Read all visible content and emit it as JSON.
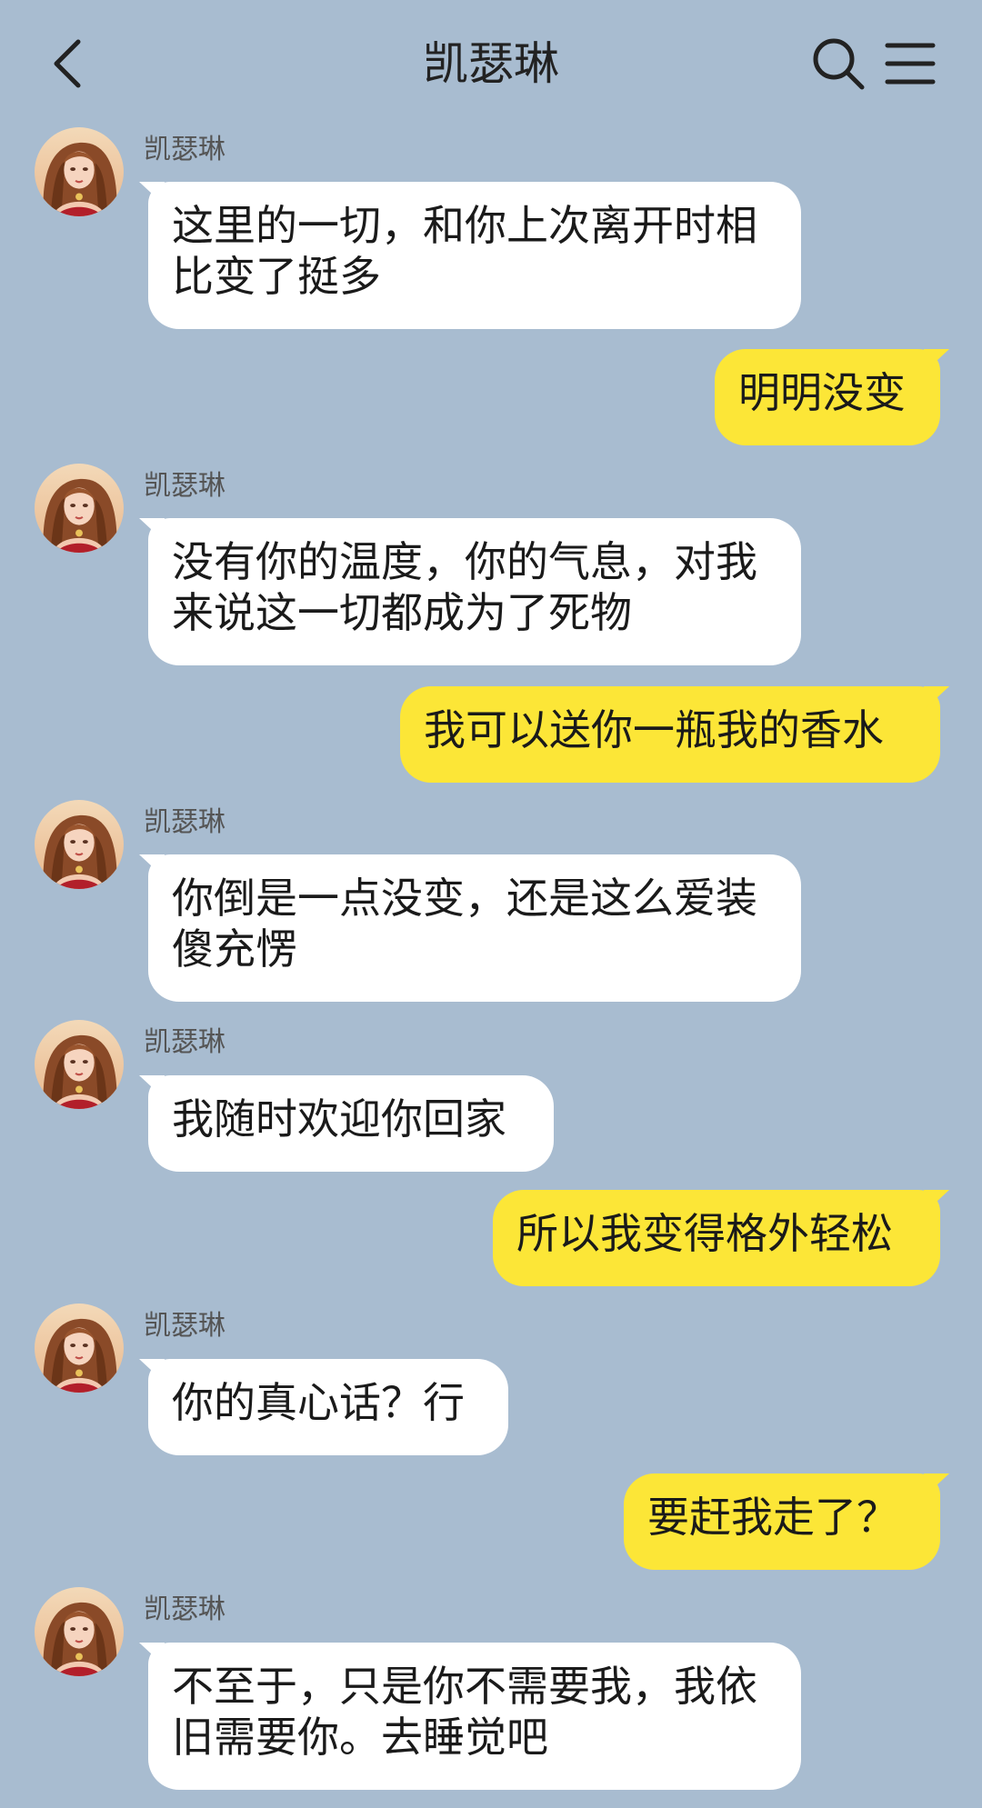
{
  "header": {
    "title": "凯瑟琳"
  },
  "messages": [
    {
      "from": "contact",
      "sender": "凯瑟琳",
      "text": "这里的一切，和你上次离开时相比变了挺多"
    },
    {
      "from": "me",
      "text": "明明没变"
    },
    {
      "from": "contact",
      "sender": "凯瑟琳",
      "text": "没有你的温度，你的气息，对我来说这一切都成为了死物"
    },
    {
      "from": "me",
      "text": "我可以送你一瓶我的香水"
    },
    {
      "from": "contact",
      "sender": "凯瑟琳",
      "text": "你倒是一点没变，还是这么爱装傻充愣"
    },
    {
      "from": "contact",
      "sender": "凯瑟琳",
      "text": "我随时欢迎你回家"
    },
    {
      "from": "me",
      "text": "所以我变得格外轻松"
    },
    {
      "from": "contact",
      "sender": "凯瑟琳",
      "text": "你的真心话？行"
    },
    {
      "from": "me",
      "text": "要赶我走了？"
    },
    {
      "from": "contact",
      "sender": "凯瑟琳",
      "text": "不至于，只是你不需要我，我依旧需要你。去睡觉吧"
    }
  ],
  "colors": {
    "background": "#a8bcd0",
    "incoming_bubble": "#ffffff",
    "outgoing_bubble": "#fce637"
  },
  "icons": {
    "back": "back-arrow-icon",
    "search": "search-icon",
    "menu": "menu-icon",
    "avatar": "avatar"
  }
}
